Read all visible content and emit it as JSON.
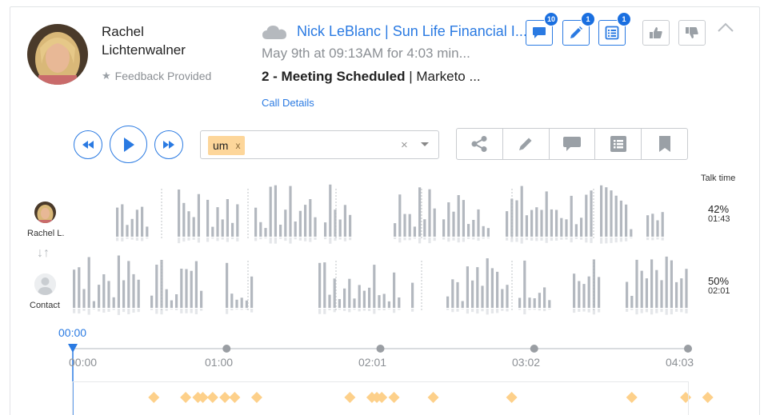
{
  "rep": {
    "name": "Rachel Lichtenwalner",
    "feedback": "Feedback Provided"
  },
  "call": {
    "title": "Nick LeBlanc | Sun Life Financial I...",
    "time": "May 9th at 09:13AM for 4:03 min...",
    "stage": "2 - Meeting Scheduled",
    "stage_rest": " | Marketo ...",
    "details_link": "Call Details"
  },
  "badges": {
    "comments": "10",
    "notes": "1",
    "outline": "1"
  },
  "filter": {
    "chip": "um",
    "chip_x": "x",
    "clear": "×"
  },
  "speakers": {
    "header": "Talk time",
    "rep_label": "Rachel L.",
    "rep_pct": "42%",
    "rep_dur": "01:43",
    "contact_label": "Contact",
    "contact_pct": "50%",
    "contact_dur": "02:01"
  },
  "timeline": {
    "current": "00:00",
    "ticks": [
      "00:00",
      "01:00",
      "02:01",
      "03:02",
      "04:03"
    ],
    "total_seconds": 243,
    "marker_seconds": [
      20,
      33,
      38,
      40,
      44,
      49,
      53,
      62,
      100,
      109,
      111,
      113,
      118,
      134,
      166,
      215,
      237,
      246
    ]
  },
  "colors": {
    "accent": "#2a7ae2",
    "bar": "#b3b8bf",
    "marker": "#fdd08a"
  },
  "icons": {
    "cloud": "cloud-icon",
    "comments": "comment-icon",
    "notes": "pencil-icon",
    "outline": "list-icon",
    "like": "thumbs-up-icon",
    "dislike": "thumbs-down-icon",
    "collapse": "chevron-up-icon",
    "rewind": "rewind-icon",
    "play": "play-icon",
    "forward": "fast-forward-icon",
    "share": "share-icon",
    "bookmark": "bookmark-icon"
  }
}
